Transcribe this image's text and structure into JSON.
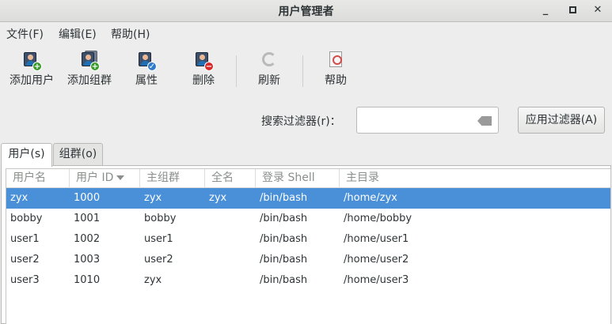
{
  "window": {
    "title": "用户管理者",
    "min": "_",
    "close": "✕"
  },
  "menu": [
    "文件(F)",
    "编辑(E)",
    "帮助(H)"
  ],
  "toolbar": {
    "add_user": "添加用户",
    "add_group": "添加组群",
    "properties": "属性",
    "delete": "删除",
    "refresh": "刷新",
    "help": "帮助"
  },
  "filter": {
    "label": "搜索过滤器(r)：",
    "value": "",
    "apply": "应用过滤器(A)"
  },
  "tabs": {
    "users": "用户(s)",
    "groups": "组群(o)"
  },
  "table": {
    "headers": [
      "用户名",
      "用户 ID",
      "主组群",
      "全名",
      "登录 Shell",
      "主目录"
    ],
    "rows": [
      [
        "zyx",
        "1000",
        "zyx",
        "zyx",
        "/bin/bash",
        "/home/zyx"
      ],
      [
        "bobby",
        "1001",
        "bobby",
        "",
        "/bin/bash",
        "/home/bobby"
      ],
      [
        "user1",
        "1002",
        "user1",
        "",
        "/bin/bash",
        "/home/user1"
      ],
      [
        "user2",
        "1003",
        "user2",
        "",
        "/bin/bash",
        "/home/user2"
      ],
      [
        "user3",
        "1010",
        "zyx",
        "",
        "/bin/bash",
        "/home/user3"
      ]
    ],
    "selected_row": 0
  },
  "colors": {
    "selection": "#4a90d9"
  }
}
